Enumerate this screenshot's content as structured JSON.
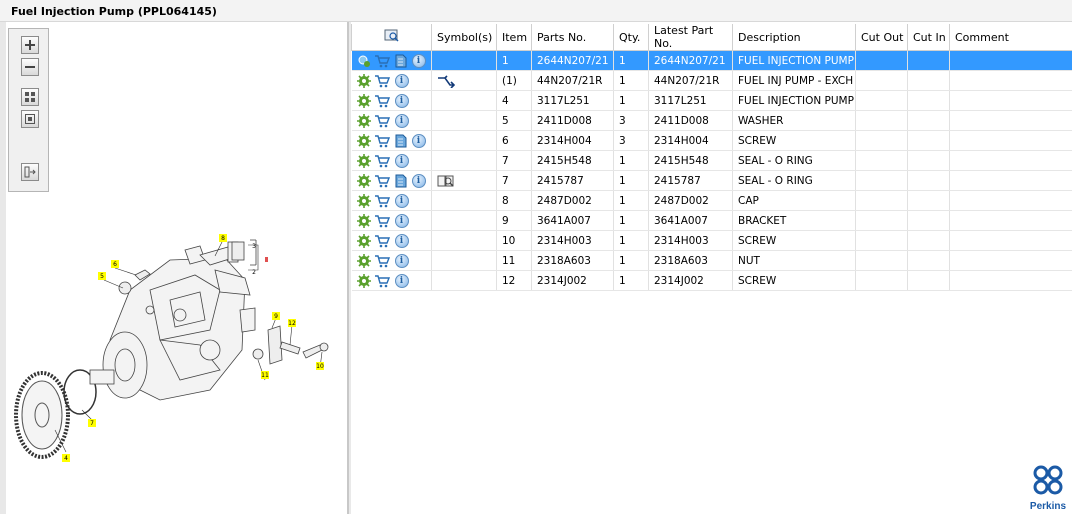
{
  "window": {
    "title": "Fuel Injection Pump (PPL064145)"
  },
  "toolbar": {
    "buttons": [
      "zoom-in-icon",
      "zoom-out-icon",
      "fit-all-icon",
      "fit-window-icon",
      "export-icon"
    ]
  },
  "diagram": {
    "callouts": [
      "1",
      "2",
      "3",
      "4",
      "5",
      "6",
      "7",
      "8",
      "9",
      "10",
      "11",
      "12"
    ]
  },
  "table": {
    "header_icon": "find-in-diagram-icon",
    "columns": [
      "Symbol(s)",
      "Item",
      "Parts No.",
      "Qty.",
      "Latest Part No.",
      "Description",
      "Cut Out",
      "Cut In",
      "Comment"
    ],
    "rows": [
      {
        "icons": [
          "locate-icon",
          "cart-icon",
          "document-icon",
          "info-icon"
        ],
        "symbol": "",
        "item": "1",
        "part": "2644N207/21",
        "qty": "1",
        "latest": "2644N207/21",
        "desc": "FUEL INJECTION PUMP",
        "cut_out": "",
        "cut_in": "",
        "comment": "",
        "selected": true
      },
      {
        "icons": [
          "gear-icon",
          "cart-icon",
          "info-icon"
        ],
        "symbol": "exchange-icon",
        "item": "(1)",
        "part": "44N207/21R",
        "qty": "1",
        "latest": "44N207/21R",
        "desc": "FUEL INJ PUMP - EXCH",
        "cut_out": "",
        "cut_in": "",
        "comment": ""
      },
      {
        "icons": [
          "gear-icon",
          "cart-icon",
          "info-icon"
        ],
        "symbol": "",
        "item": "4",
        "part": "3117L251",
        "qty": "1",
        "latest": "3117L251",
        "desc": "FUEL INJECTION PUMP G",
        "cut_out": "",
        "cut_in": "",
        "comment": ""
      },
      {
        "icons": [
          "gear-icon",
          "cart-icon",
          "info-icon"
        ],
        "symbol": "",
        "item": "5",
        "part": "2411D008",
        "qty": "3",
        "latest": "2411D008",
        "desc": "WASHER",
        "cut_out": "",
        "cut_in": "",
        "comment": ""
      },
      {
        "icons": [
          "gear-icon",
          "cart-icon",
          "document-icon",
          "info-icon"
        ],
        "symbol": "",
        "item": "6",
        "part": "2314H004",
        "qty": "3",
        "latest": "2314H004",
        "desc": "SCREW",
        "cut_out": "",
        "cut_in": "",
        "comment": ""
      },
      {
        "icons": [
          "gear-icon",
          "cart-icon",
          "info-icon"
        ],
        "symbol": "",
        "item": "7",
        "part": "2415H548",
        "qty": "1",
        "latest": "2415H548",
        "desc": "SEAL - O RING",
        "cut_out": "",
        "cut_in": "",
        "comment": ""
      },
      {
        "icons": [
          "gear-icon",
          "cart-icon",
          "document-icon",
          "info-icon"
        ],
        "symbol": "book-search-icon",
        "item": "7",
        "part": "2415787",
        "qty": "1",
        "latest": "2415787",
        "desc": "SEAL - O RING",
        "cut_out": "",
        "cut_in": "",
        "comment": ""
      },
      {
        "icons": [
          "gear-icon",
          "cart-icon",
          "info-icon"
        ],
        "symbol": "",
        "item": "8",
        "part": "2487D002",
        "qty": "1",
        "latest": "2487D002",
        "desc": "CAP",
        "cut_out": "",
        "cut_in": "",
        "comment": ""
      },
      {
        "icons": [
          "gear-icon",
          "cart-icon",
          "info-icon"
        ],
        "symbol": "",
        "item": "9",
        "part": "3641A007",
        "qty": "1",
        "latest": "3641A007",
        "desc": "BRACKET",
        "cut_out": "",
        "cut_in": "",
        "comment": ""
      },
      {
        "icons": [
          "gear-icon",
          "cart-icon",
          "info-icon"
        ],
        "symbol": "",
        "item": "10",
        "part": "2314H003",
        "qty": "1",
        "latest": "2314H003",
        "desc": "SCREW",
        "cut_out": "",
        "cut_in": "",
        "comment": ""
      },
      {
        "icons": [
          "gear-icon",
          "cart-icon",
          "info-icon"
        ],
        "symbol": "",
        "item": "11",
        "part": "2318A603",
        "qty": "1",
        "latest": "2318A603",
        "desc": "NUT",
        "cut_out": "",
        "cut_in": "",
        "comment": ""
      },
      {
        "icons": [
          "gear-icon",
          "cart-icon",
          "info-icon"
        ],
        "symbol": "",
        "item": "12",
        "part": "2314J002",
        "qty": "1",
        "latest": "2314J002",
        "desc": "SCREW",
        "cut_out": "",
        "cut_in": "",
        "comment": ""
      }
    ]
  },
  "brand": {
    "name": "Perkins",
    "color": "#1b5aa6"
  },
  "colors": {
    "selection": "#3399ff",
    "callout": "#ffff00",
    "gear": "#5aa02c"
  }
}
